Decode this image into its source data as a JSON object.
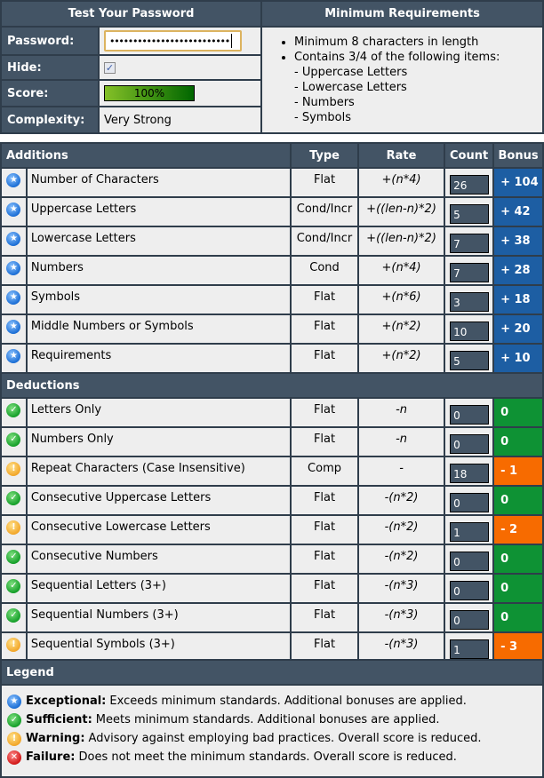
{
  "test_panel": {
    "title": "Test Your Password",
    "password_label": "Password:",
    "password_value": "••••••••••••••••••••••••••",
    "hide_label": "Hide:",
    "hide_checked": true,
    "score_label": "Score:",
    "score_value": "100%",
    "score_percent": 100,
    "complexity_label": "Complexity:",
    "complexity_value": "Very Strong"
  },
  "requirements": {
    "title": "Minimum Requirements",
    "items": [
      "Minimum 8 characters in length",
      "Contains 3/4 of the following items:"
    ],
    "subitems": [
      "- Uppercase Letters",
      "- Lowercase Letters",
      "- Numbers",
      "- Symbols"
    ]
  },
  "columns": {
    "type": "Type",
    "rate": "Rate",
    "count": "Count",
    "bonus": "Bonus"
  },
  "additions": {
    "title": "Additions",
    "rows": [
      {
        "icon": "exceptional-icon",
        "name": "Number of Characters",
        "type": "Flat",
        "rate": "+(n*4)",
        "count": "26",
        "bonus": "+ 104",
        "status": "blue"
      },
      {
        "icon": "exceptional-icon",
        "name": "Uppercase Letters",
        "type": "Cond/Incr",
        "rate": "+((len-n)*2)",
        "count": "5",
        "bonus": "+ 42",
        "status": "blue"
      },
      {
        "icon": "exceptional-icon",
        "name": "Lowercase Letters",
        "type": "Cond/Incr",
        "rate": "+((len-n)*2)",
        "count": "7",
        "bonus": "+ 38",
        "status": "blue"
      },
      {
        "icon": "exceptional-icon",
        "name": "Numbers",
        "type": "Cond",
        "rate": "+(n*4)",
        "count": "7",
        "bonus": "+ 28",
        "status": "blue"
      },
      {
        "icon": "exceptional-icon",
        "name": "Symbols",
        "type": "Flat",
        "rate": "+(n*6)",
        "count": "3",
        "bonus": "+ 18",
        "status": "blue"
      },
      {
        "icon": "exceptional-icon",
        "name": "Middle Numbers or Symbols",
        "type": "Flat",
        "rate": "+(n*2)",
        "count": "10",
        "bonus": "+ 20",
        "status": "blue"
      },
      {
        "icon": "exceptional-icon",
        "name": "Requirements",
        "type": "Flat",
        "rate": "+(n*2)",
        "count": "5",
        "bonus": "+ 10",
        "status": "blue"
      }
    ]
  },
  "deductions": {
    "title": "Deductions",
    "rows": [
      {
        "icon": "sufficient-icon",
        "name": "Letters Only",
        "type": "Flat",
        "rate": "-n",
        "count": "0",
        "bonus": "0",
        "status": "green"
      },
      {
        "icon": "sufficient-icon",
        "name": "Numbers Only",
        "type": "Flat",
        "rate": "-n",
        "count": "0",
        "bonus": "0",
        "status": "green"
      },
      {
        "icon": "warning-icon",
        "name": "Repeat Characters (Case Insensitive)",
        "type": "Comp",
        "rate": "-",
        "count": "18",
        "bonus": "- 1",
        "status": "orange"
      },
      {
        "icon": "sufficient-icon",
        "name": "Consecutive Uppercase Letters",
        "type": "Flat",
        "rate": "-(n*2)",
        "count": "0",
        "bonus": "0",
        "status": "green"
      },
      {
        "icon": "warning-icon",
        "name": "Consecutive Lowercase Letters",
        "type": "Flat",
        "rate": "-(n*2)",
        "count": "1",
        "bonus": "- 2",
        "status": "orange"
      },
      {
        "icon": "sufficient-icon",
        "name": "Consecutive Numbers",
        "type": "Flat",
        "rate": "-(n*2)",
        "count": "0",
        "bonus": "0",
        "status": "green"
      },
      {
        "icon": "sufficient-icon",
        "name": "Sequential Letters (3+)",
        "type": "Flat",
        "rate": "-(n*3)",
        "count": "0",
        "bonus": "0",
        "status": "green"
      },
      {
        "icon": "sufficient-icon",
        "name": "Sequential Numbers (3+)",
        "type": "Flat",
        "rate": "-(n*3)",
        "count": "0",
        "bonus": "0",
        "status": "green"
      },
      {
        "icon": "warning-icon",
        "name": "Sequential Symbols (3+)",
        "type": "Flat",
        "rate": "-(n*3)",
        "count": "1",
        "bonus": "- 3",
        "status": "orange"
      }
    ]
  },
  "legend": {
    "title": "Legend",
    "items": [
      {
        "icon": "exceptional-icon",
        "term": "Exceptional:",
        "text": "Exceeds minimum standards. Additional bonuses are applied."
      },
      {
        "icon": "sufficient-icon",
        "term": "Sufficient:",
        "text": "Meets minimum standards. Additional bonuses are applied."
      },
      {
        "icon": "warning-icon",
        "term": "Warning:",
        "text": "Advisory against employing bad practices. Overall score is reduced."
      },
      {
        "icon": "failure-icon",
        "term": "Failure:",
        "text": "Does not meet the minimum standards. Overall score is reduced."
      }
    ]
  },
  "colors": {
    "header_bg": "#435465",
    "bonus_blue": "#1d5ea3",
    "bonus_green": "#0e9234",
    "bonus_orange": "#f76b00",
    "score_bar_start": "#84c027",
    "score_bar_end": "#006600"
  }
}
